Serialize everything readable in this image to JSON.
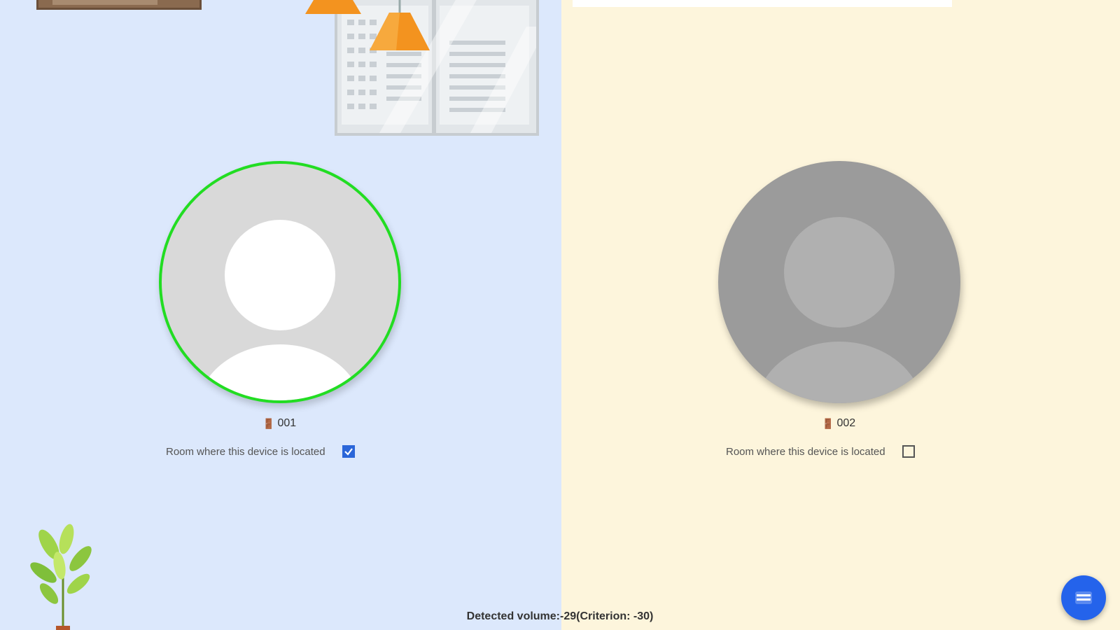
{
  "rooms": [
    {
      "id": "001",
      "located_label": "Room where this device is located",
      "checked": true
    },
    {
      "id": "002",
      "located_label": "Room where this device is located",
      "checked": false
    }
  ],
  "status": {
    "text": "Detected volume:-29(Criterion: -30)"
  },
  "colors": {
    "left_bg": "#dce8fc",
    "right_bg": "#fdf5dc",
    "active_ring": "#22dd22",
    "accent": "#2463eb"
  },
  "icons": {
    "room": "room-door-icon",
    "fab": "menu-icon"
  }
}
